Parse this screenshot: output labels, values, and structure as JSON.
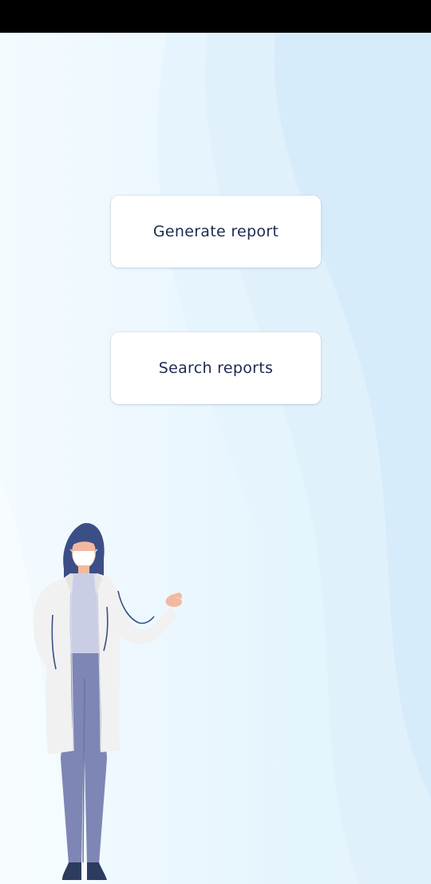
{
  "screen": {
    "status_bar_color": "#000000",
    "background_colors": [
      "#f4fbff",
      "#e3f3fd",
      "#d6ecfc"
    ]
  },
  "actions": {
    "generate_label": "Generate report",
    "search_label": "Search reports"
  },
  "illustration": {
    "icon": "doctor-illustration",
    "colors": {
      "coat": "#f1f1f1",
      "hair": "#3b4f86",
      "trousers": "#7d86b4",
      "shirt": "#c9cee6",
      "skin": "#f3b9a0"
    }
  }
}
